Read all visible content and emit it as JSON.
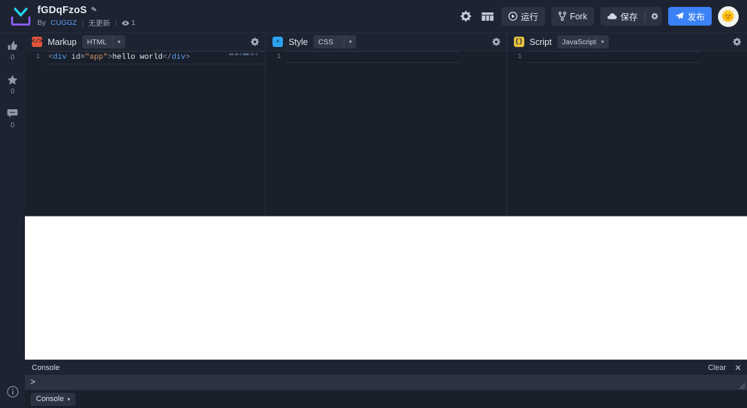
{
  "header": {
    "logo_icon": "codepen-chevron-logo",
    "pen_title": "fGDqFzoS",
    "edit_icon": "pencil-icon",
    "by_label": "By",
    "author": "CUGGZ",
    "separator": "|",
    "update_status": "无更新",
    "views_icon": "eye-icon",
    "views_count": "1",
    "actions": {
      "settings_icon": "gear-icon",
      "layout_icon": "layout-grid-icon",
      "run_label": "运行",
      "run_icon": "play-circle-icon",
      "fork_label": "Fork",
      "fork_icon": "fork-branch-icon",
      "save_label": "保存",
      "save_icon": "cloud-icon",
      "save_options_icon": "gear-icon",
      "publish_label": "发布",
      "publish_icon": "paper-plane-icon",
      "avatar_icon": "sun-face-avatar"
    },
    "accent_color": "#3b82f6",
    "logo_colors": {
      "chevron": "#22d3ee",
      "box": "#8b5cf6"
    }
  },
  "rail": {
    "items": [
      {
        "icon": "thumbs-up-icon",
        "name": "like",
        "count": "0"
      },
      {
        "icon": "star-icon",
        "name": "favorite",
        "count": "0"
      },
      {
        "icon": "comment-bubble-icon",
        "name": "comments",
        "count": "0"
      }
    ],
    "info_icon": "info-circle-icon"
  },
  "editors": [
    {
      "badge_text": "</>",
      "badge_color": "#e2543c",
      "badge_icon": "markup-code-icon",
      "name": "Markup",
      "language": "HTML",
      "caret_icon": "chevron-down-icon",
      "gear_icon": "gear-icon",
      "line_number": "1",
      "code_tokens": [
        {
          "t": "<",
          "c": "tok-punct"
        },
        {
          "t": "div",
          "c": "tok-tag"
        },
        {
          "t": " id=",
          "c": "tok-attr"
        },
        {
          "t": "\"app\"",
          "c": "tok-str"
        },
        {
          "t": ">",
          "c": "tok-punct"
        },
        {
          "t": "hello world",
          "c": "tok-text"
        },
        {
          "t": "</",
          "c": "tok-punct"
        },
        {
          "t": "div",
          "c": "tok-tag"
        },
        {
          "t": ">",
          "c": "tok-punct"
        }
      ]
    },
    {
      "badge_text": "✳",
      "badge_color": "#2ba3ef",
      "badge_icon": "style-asterisk-icon",
      "name": "Style",
      "language": "CSS",
      "caret_icon": "chevron-down-icon",
      "gear_icon": "gear-icon",
      "line_number": "1",
      "code_tokens": []
    },
    {
      "badge_text": "{}",
      "badge_color": "#e8c140",
      "badge_icon": "script-braces-icon",
      "name": "Script",
      "language": "JavaScript",
      "caret_icon": "chevron-down-icon",
      "gear_icon": "gear-icon",
      "line_number": "1",
      "code_tokens": []
    }
  ],
  "preview": {
    "background": "#ffffff",
    "content": ""
  },
  "console": {
    "title": "Console",
    "clear_label": "Clear",
    "close_icon": "close-x-icon",
    "prompt_symbol": ">",
    "input_value": "",
    "resize_icon": "resize-grip-icon",
    "tab_label": "Console",
    "tab_caret_icon": "chevron-down-icon"
  }
}
